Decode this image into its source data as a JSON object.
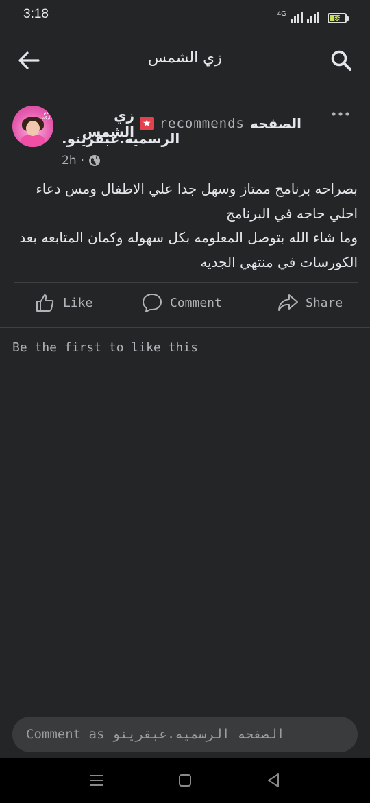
{
  "status_bar": {
    "time": "3:18",
    "network": "4G",
    "battery_level": 66,
    "battery_label": "66"
  },
  "top_bar": {
    "title": "زي الشمس"
  },
  "post": {
    "reviewer_name": "زي الشمس",
    "recommends_text": "recommends",
    "page_name_line1": "الصفحه",
    "page_name_line2": "الرسميه.عبقرينو.",
    "time": "2h",
    "dot": "·",
    "body_lines": [
      "بصراحه برنامج ممتاز وسهل جدا علي الاطفال ومس دعاء",
      "احلي حاجه في البرنامج",
      "وما شاء الله بتوصل المعلومه بكل سهوله وكمان المتابعه بعد",
      "الكورسات في منتهي الجديه"
    ],
    "actions": {
      "like": "Like",
      "comment": "Comment",
      "share": "Share"
    },
    "first_like": "Be the first to like this",
    "avatar_text": "سلام عليكم"
  },
  "comment": {
    "placeholder": "Comment as الصفحه الرسميه.عبقرينو"
  },
  "colors": {
    "background": "#242526",
    "text": "#e4e6eb",
    "muted": "#b0b3b8",
    "badge": "#e4414f",
    "input_bg": "#3a3b3c"
  }
}
